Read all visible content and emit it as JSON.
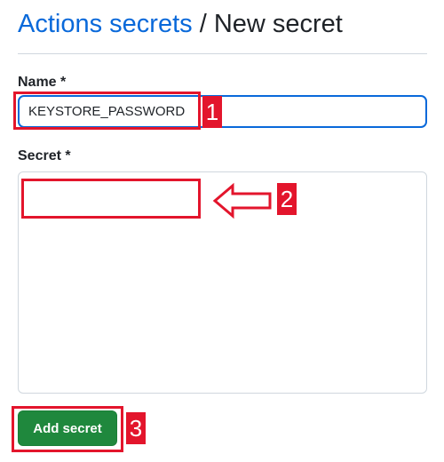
{
  "header": {
    "breadcrumb_link": "Actions secrets",
    "separator": " / ",
    "current_page": "New secret"
  },
  "form": {
    "name_label": "Name *",
    "name_value": "KEYSTORE_PASSWORD",
    "secret_label": "Secret *",
    "secret_value": "",
    "submit_label": "Add secret"
  },
  "annotations": {
    "step_1": "1",
    "step_2": "2",
    "step_3": "3",
    "highlight_color": "#e3152c",
    "pointer_icon": "left-arrow-icon"
  }
}
